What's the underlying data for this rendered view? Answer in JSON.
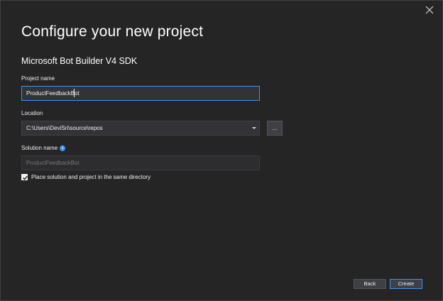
{
  "dialog": {
    "title": "Configure your new project",
    "template_name": "Microsoft Bot Builder V4 SDK",
    "close_icon": "close-icon"
  },
  "project_name": {
    "label": "Project name",
    "value": "ProductFeedbackBot"
  },
  "location": {
    "label": "Location",
    "value": "C:\\Users\\DeviSri\\source\\repos",
    "browse_label": "..."
  },
  "solution_name": {
    "label": "Solution name",
    "info_glyph": "i",
    "placeholder": "ProductFeedbackBot"
  },
  "same_directory": {
    "checked": true,
    "label": "Place solution and project in the same directory"
  },
  "buttons": {
    "back": "Back",
    "create": "Create"
  },
  "colors": {
    "background": "#252526",
    "input_background": "#333337",
    "accent": "#3794ff",
    "text": "#f1f1f1"
  }
}
